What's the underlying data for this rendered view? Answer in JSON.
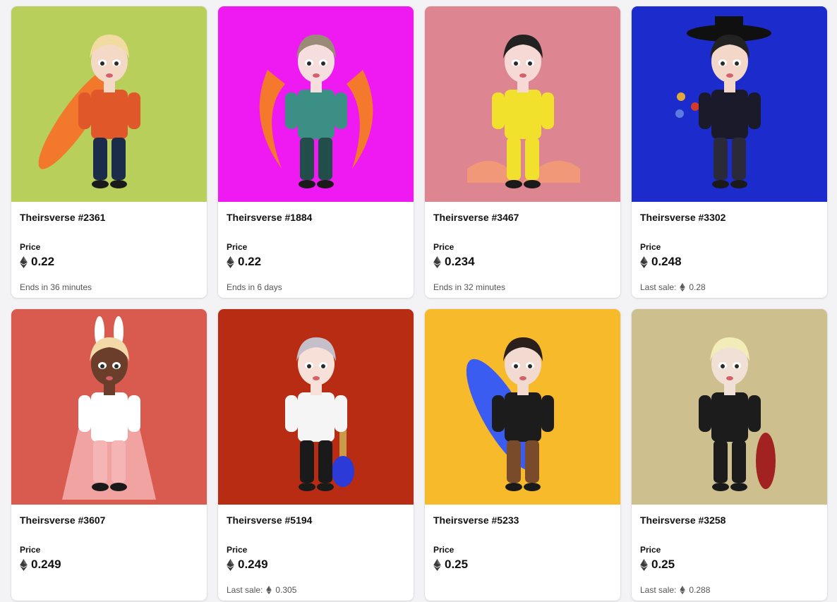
{
  "eth_icon": "ethereum-icon",
  "price_label": "Price",
  "cards": [
    {
      "name": "Theirsverse #2361",
      "price": "0.22",
      "footer_text": "Ends in 36 minutes",
      "last_sale_label": "",
      "last_sale_value": "",
      "bg": "#b8cf5c",
      "art": "character-with-surfboard"
    },
    {
      "name": "Theirsverse #1884",
      "price": "0.22",
      "footer_text": "Ends in 6 days",
      "last_sale_label": "",
      "last_sale_value": "",
      "bg": "#ef1af2",
      "art": "character-with-flames"
    },
    {
      "name": "Theirsverse #3467",
      "price": "0.234",
      "footer_text": "Ends in 32 minutes",
      "last_sale_label": "",
      "last_sale_value": "",
      "bg": "#dd8691",
      "art": "character-yellow-suit"
    },
    {
      "name": "Theirsverse #3302",
      "price": "0.248",
      "footer_text": "",
      "last_sale_label": "Last sale:",
      "last_sale_value": "0.28",
      "bg": "#1c2ccc",
      "art": "character-with-hat"
    },
    {
      "name": "Theirsverse #3607",
      "price": "0.249",
      "footer_text": "",
      "last_sale_label": "",
      "last_sale_value": "",
      "bg": "#d95a4f",
      "art": "character-bunny-ears"
    },
    {
      "name": "Theirsverse #5194",
      "price": "0.249",
      "footer_text": "",
      "last_sale_label": "Last sale:",
      "last_sale_value": "0.305",
      "bg": "#b72c12",
      "art": "character-with-guitar"
    },
    {
      "name": "Theirsverse #5233",
      "price": "0.25",
      "footer_text": "",
      "last_sale_label": "",
      "last_sale_value": "",
      "bg": "#f6ba2a",
      "art": "character-with-skateboard"
    },
    {
      "name": "Theirsverse #3258",
      "price": "0.25",
      "footer_text": "",
      "last_sale_label": "Last sale:",
      "last_sale_value": "0.288",
      "bg": "#cdbf8e",
      "art": "character-with-skateboard-standing"
    }
  ]
}
